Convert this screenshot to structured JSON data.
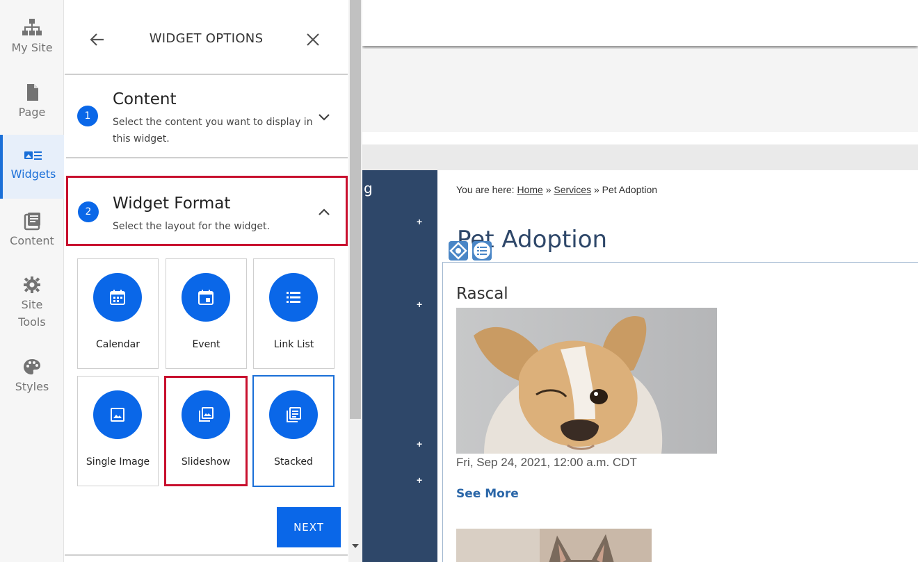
{
  "rail": {
    "items": [
      {
        "label": "My Site"
      },
      {
        "label": "Page"
      },
      {
        "label": "Widgets"
      },
      {
        "label": "Content"
      },
      {
        "label": "Site Tools"
      },
      {
        "label": "Styles"
      }
    ],
    "active": "Widgets"
  },
  "panel": {
    "title": "WIDGET OPTIONS",
    "steps": [
      {
        "num": "1",
        "title": "Content",
        "desc": "Select the content you want to display in this widget."
      },
      {
        "num": "2",
        "title": "Widget Format",
        "desc": "Select the layout for the widget."
      }
    ],
    "formats": [
      {
        "label": "Calendar",
        "icon": "calendar-icon"
      },
      {
        "label": "Event",
        "icon": "event-icon"
      },
      {
        "label": "Link List",
        "icon": "list-icon"
      },
      {
        "label": "Single Image",
        "icon": "image-icon"
      },
      {
        "label": "Slideshow",
        "icon": "slideshow-icon"
      },
      {
        "label": "Stacked",
        "icon": "stacked-icon"
      }
    ],
    "selected_format": "Stacked",
    "next_label": "NEXT"
  },
  "preview": {
    "nav_fragment": "g",
    "breadcrumb": {
      "prefix": "You are here:",
      "home": "Home",
      "sep": "»",
      "services": " Services",
      "current": "Pet Adoption"
    },
    "page_title": "Pet Adoption",
    "item": {
      "title": "Rascal",
      "date": "Fri, Sep 24, 2021, 12:00 a.m. CDT",
      "link": "See More"
    }
  },
  "colors": {
    "accent": "#0a67e8",
    "highlight": "#c8102e",
    "nav": "#2e4769"
  }
}
